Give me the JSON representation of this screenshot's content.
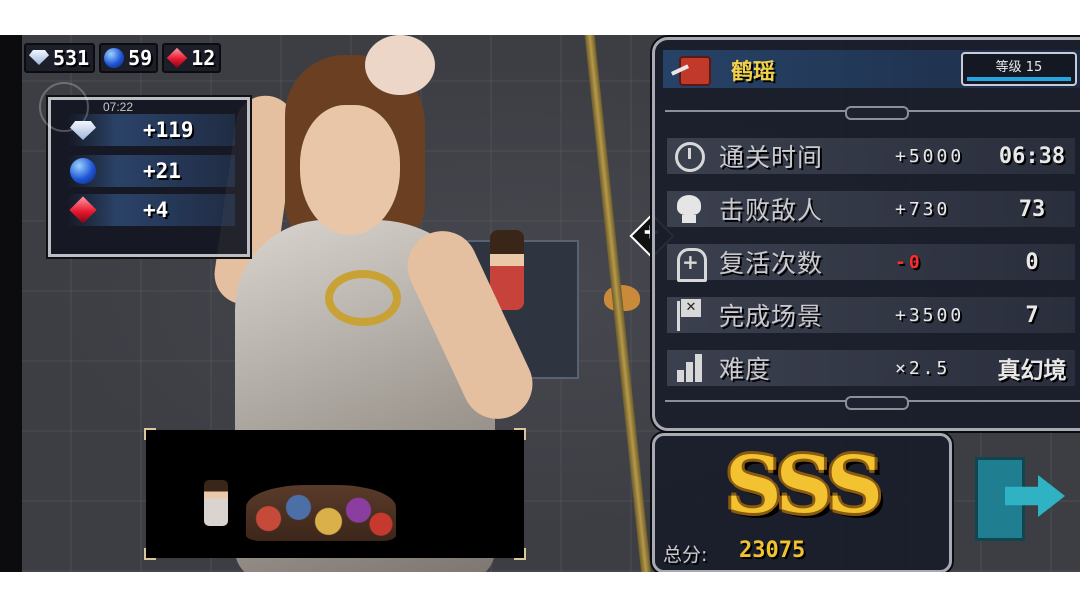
{
  "currency": {
    "diamonds": "531",
    "sapphires": "59",
    "rubies": "12"
  },
  "rewards": {
    "time": "07:22",
    "diamonds_gain": "+119",
    "sapphires_gain": "+21",
    "rubies_gain": "+4"
  },
  "character": {
    "name": "鹤瑶",
    "level_label": "等级 15"
  },
  "stats": [
    {
      "label": "通关时间",
      "bonus": "+5000",
      "value": "06:38",
      "icon": "clock-icon"
    },
    {
      "label": "击败敌人",
      "bonus": "+730",
      "value": "73",
      "icon": "skull-icon"
    },
    {
      "label": "复活次数",
      "bonus": "-0",
      "value": "0",
      "icon": "revive-icon"
    },
    {
      "label": "完成场景",
      "bonus": "+3500",
      "value": "7",
      "icon": "flag-icon"
    },
    {
      "label": "难度",
      "bonus": "×2.5",
      "value": "真幻境",
      "icon": "difficulty-bars-icon"
    }
  ],
  "score": {
    "grade": "SSS",
    "total_label": "总分:",
    "total_value": "23075"
  },
  "colors": {
    "gold": "#f2c230",
    "name_yellow": "#f2d24a",
    "negative_red": "#ff2a2a",
    "exit_teal": "#2fb3c4"
  }
}
